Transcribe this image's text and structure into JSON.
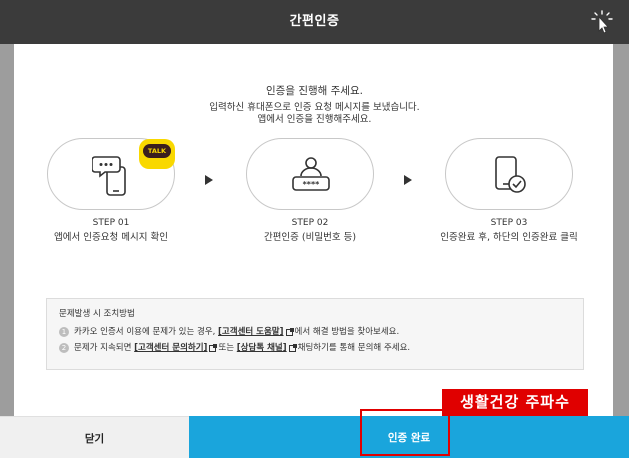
{
  "header": {
    "title": "간편인증",
    "icon": "cursor-sparkle-icon"
  },
  "intro": {
    "line1": "인증을 진행해 주세요.",
    "line2": "입력하신 휴대폰으로 인증 요청 메시지를 보냈습니다.",
    "line3": "앱에서 인증을 진행해주세요."
  },
  "steps": [
    {
      "step": "STEP 01",
      "desc": "앱에서 인증요청 메시지 확인",
      "icon": "phone-message-icon",
      "badge": "TALK"
    },
    {
      "step": "STEP 02",
      "desc": "간편인증 (비밀번호 등)",
      "icon": "password-user-icon"
    },
    {
      "step": "STEP 03",
      "desc": "인증완료 후, 하단의 인증완료 클릭",
      "icon": "phone-check-icon"
    }
  ],
  "notice": {
    "title": "문제발생 시 조치방법",
    "item1_num": "1",
    "item1_pre": "카카오 인증서 이용에 문제가 있는 경우,",
    "item1_link": "[고객센터 도움말]",
    "item1_post": "에서 해결 방법을 찾아보세요.",
    "item2_num": "2",
    "item2_pre": "문제가 지속되면",
    "item2_link1": "[고객센터 문의하기]",
    "item2_mid": "또는",
    "item2_link2": "[상담톡 채널]",
    "item2_post": "채팅하기를 통해 문의해 주세요."
  },
  "buttons": {
    "close": "닫기",
    "confirm": "인증 완료"
  },
  "overlay": {
    "label": "생활건강 주파수"
  },
  "colors": {
    "header_bg": "#3b3b3b",
    "confirm_bg": "#1aa5dc",
    "talk_yellow": "#f9d800",
    "highlight": "#e00000"
  }
}
